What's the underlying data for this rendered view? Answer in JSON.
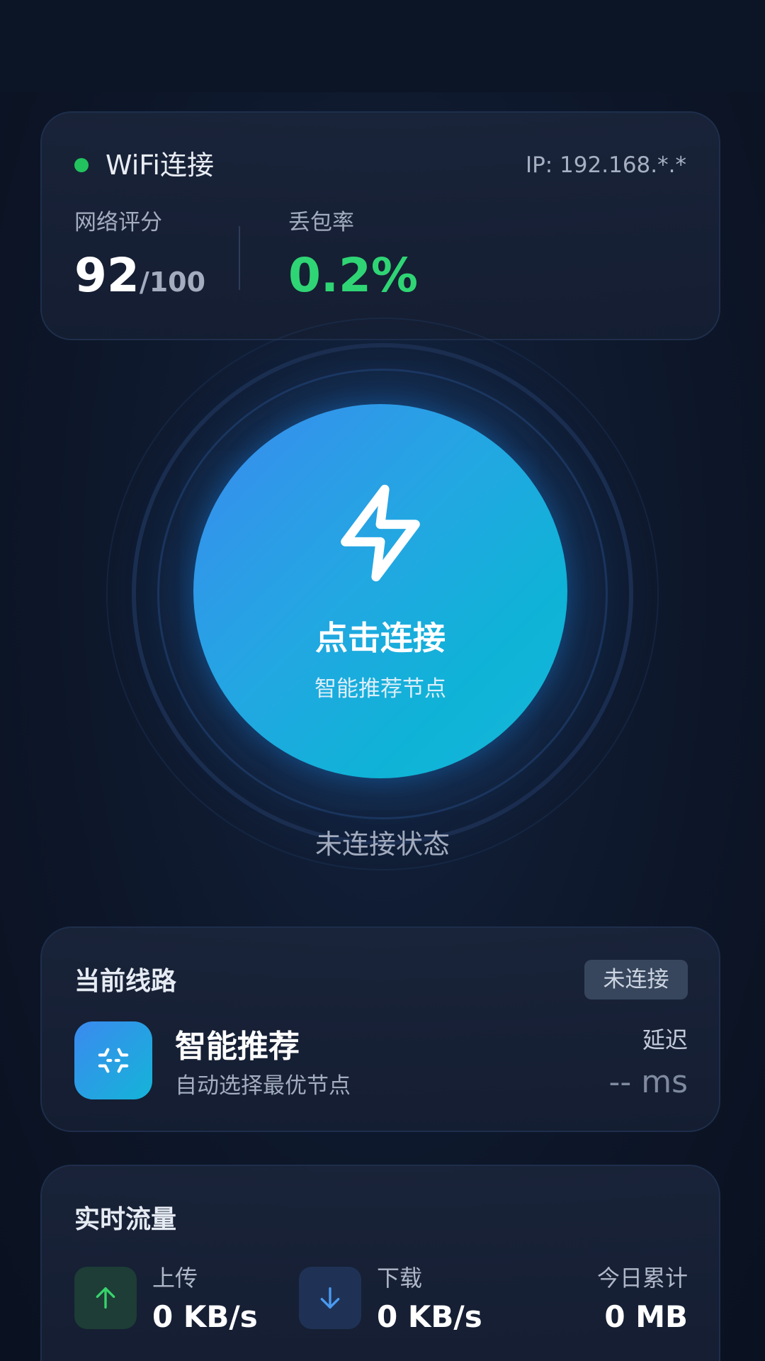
{
  "network": {
    "connection_type": "WiFi连接",
    "status_color": "#22c35e",
    "ip": "IP: 192.168.*.*",
    "score_label": "网络评分",
    "score_value": "92",
    "score_max": "/100",
    "loss_label": "丢包率",
    "loss_value": "0.2%",
    "loss_color": "#2fd574"
  },
  "connect": {
    "button_label": "点击连接",
    "button_sub": "智能推荐节点",
    "status": "未连接状态",
    "icon": "lightning-bolt-icon"
  },
  "route": {
    "title": "当前线路",
    "badge": "未连接",
    "name": "智能推荐",
    "description": "自动选择最优节点",
    "latency_label": "延迟",
    "latency_value": "-- ms",
    "icon": "route-optimize-icon"
  },
  "traffic": {
    "title": "实时流量",
    "upload_label": "上传",
    "upload_value": "0 KB/s",
    "download_label": "下载",
    "download_value": "0 KB/s",
    "total_label": "今日累计",
    "total_value": "0 MB",
    "upload_icon": "arrow-up-icon",
    "download_icon": "arrow-down-icon"
  },
  "colors": {
    "accent": "#2196f3",
    "background": "#0d1526"
  }
}
